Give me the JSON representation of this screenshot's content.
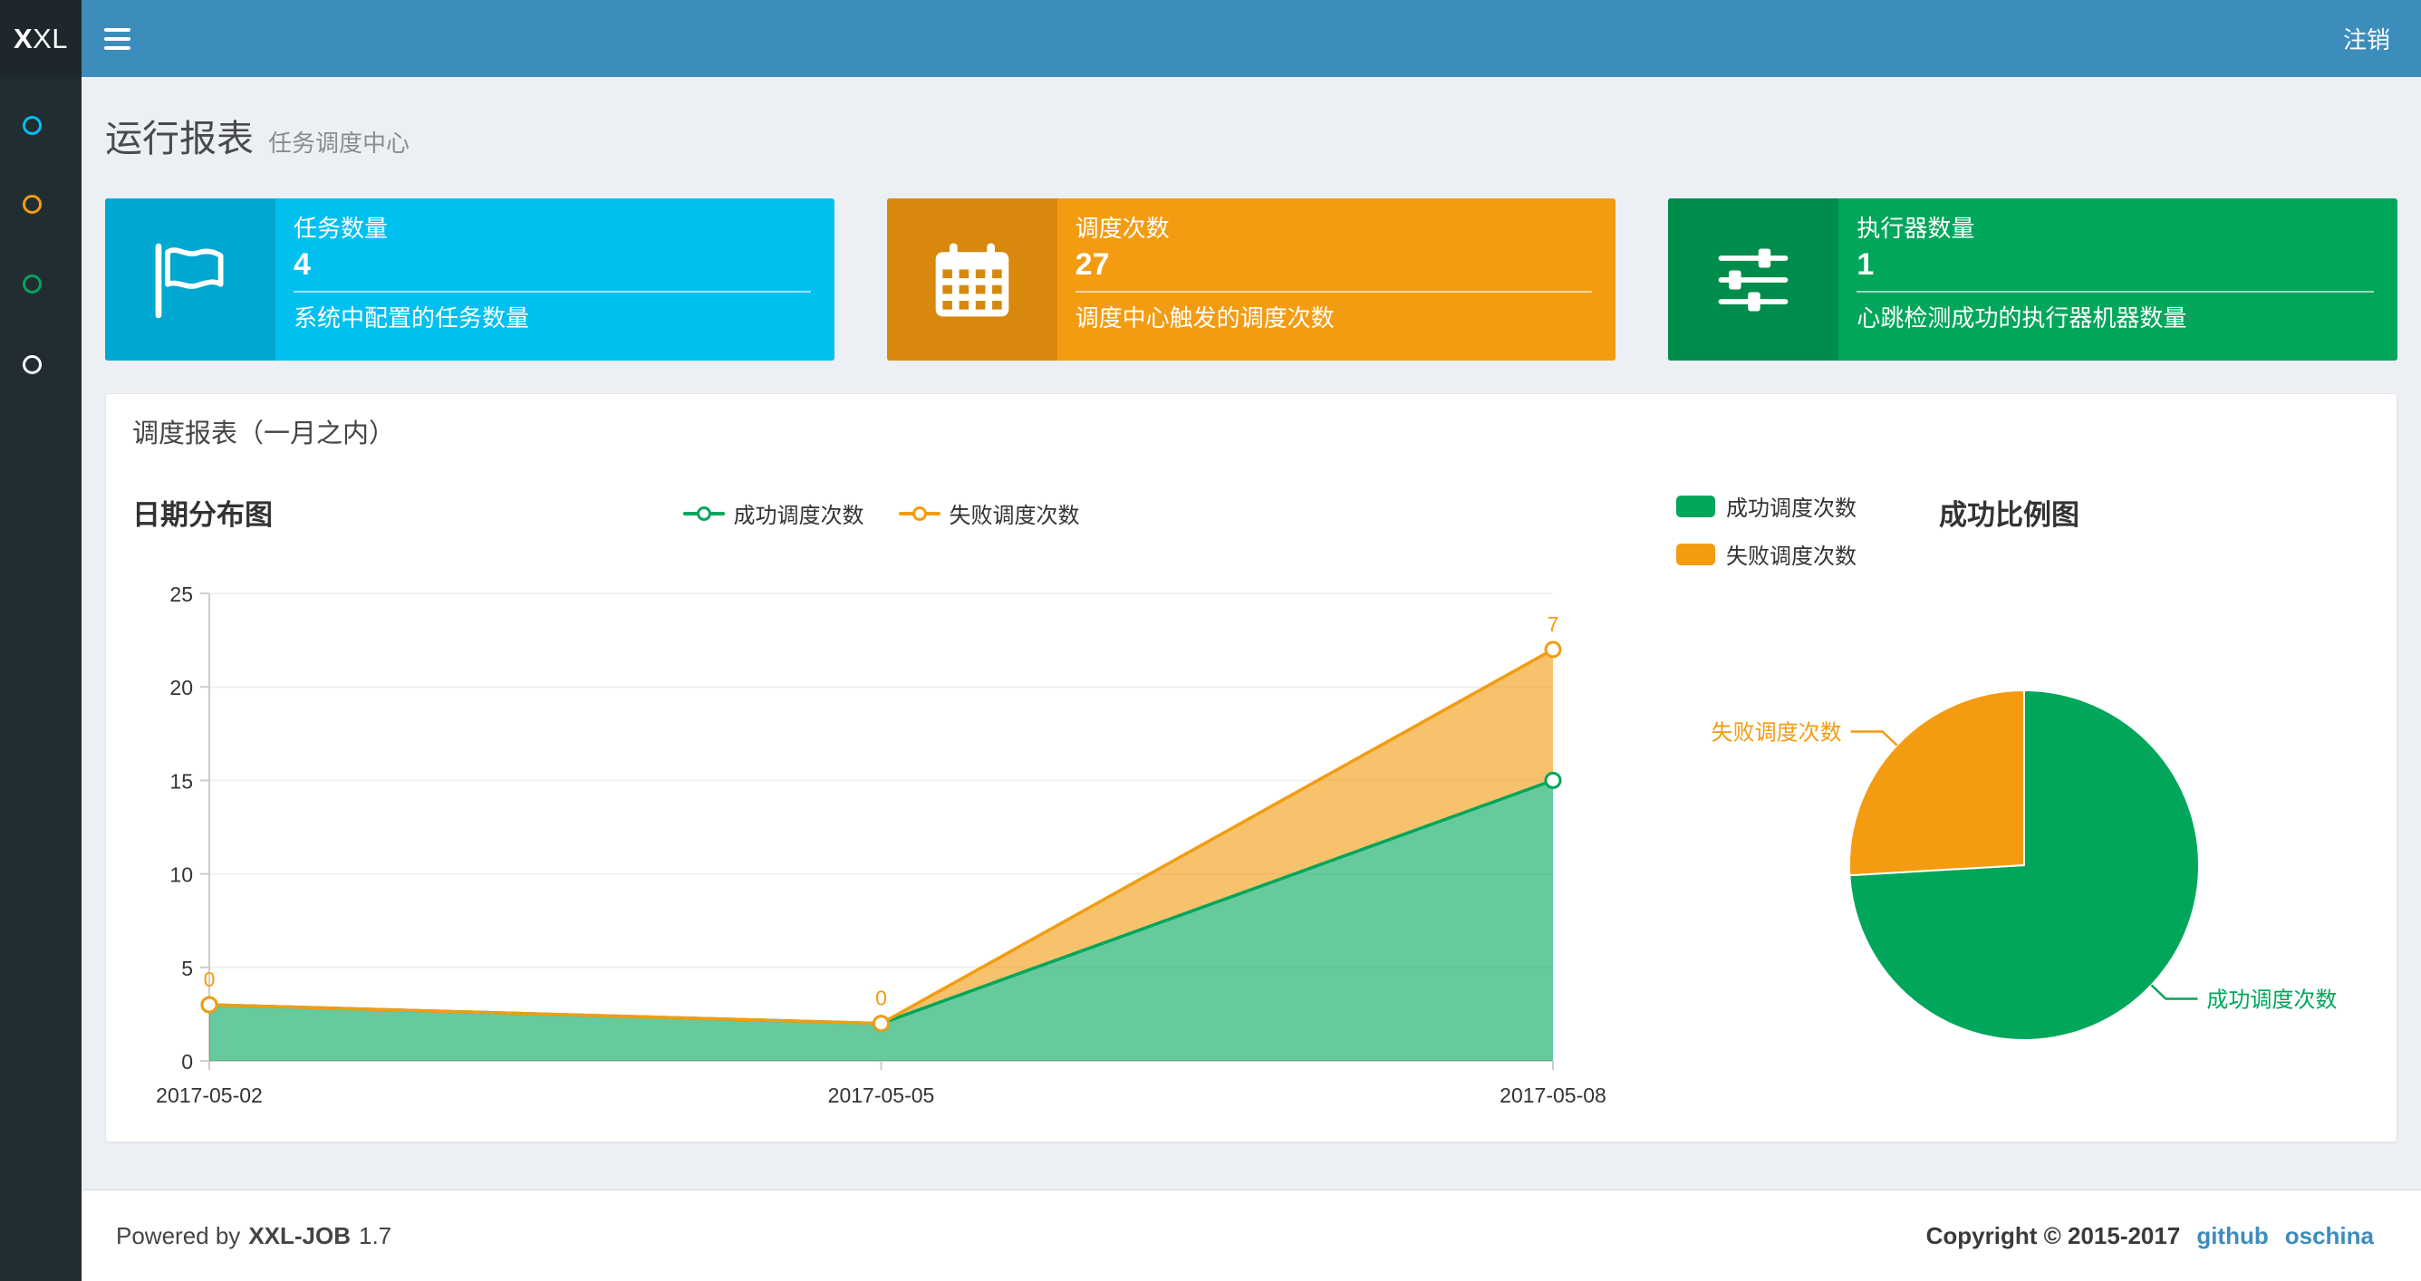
{
  "navbar": {
    "logo_bold": "X",
    "logo_rest": "XL",
    "logout_label": "注销"
  },
  "sidebar": {
    "items": [
      {
        "name": "dashboard",
        "color": "#00c0ef"
      },
      {
        "name": "job-manage",
        "color": "#f39c12"
      },
      {
        "name": "job-log",
        "color": "#00a65a"
      },
      {
        "name": "executor-manage",
        "color": "#ffffff"
      }
    ]
  },
  "page_header": {
    "title": "运行报表",
    "subtitle": "任务调度中心"
  },
  "info_boxes": [
    {
      "title": "任务数量",
      "value": "4",
      "desc": "系统中配置的任务数量",
      "bg": "#00c0ef",
      "icon_bg": "#00a7d0",
      "icon": "flag-icon"
    },
    {
      "title": "调度次数",
      "value": "27",
      "desc": "调度中心触发的调度次数",
      "bg": "#f39c12",
      "icon_bg": "#d8880c",
      "icon": "calendar-icon"
    },
    {
      "title": "执行器数量",
      "value": "1",
      "desc": "心跳检测成功的执行器机器数量",
      "bg": "#00a65a",
      "icon_bg": "#008d4c",
      "icon": "sliders-icon"
    }
  ],
  "panel": {
    "title": "调度报表（一月之内）"
  },
  "chart_data": [
    {
      "type": "area",
      "title": "日期分布图",
      "x": [
        "2017-05-02",
        "2017-05-05",
        "2017-05-08"
      ],
      "stacked": true,
      "series": [
        {
          "name": "成功调度次数",
          "color": "#00a65a",
          "values": [
            3,
            2,
            15
          ]
        },
        {
          "name": "失败调度次数",
          "color": "#f39c12",
          "values": [
            0,
            0,
            7
          ],
          "show_point_labels": true,
          "point_labels": [
            "0",
            "0",
            "7"
          ]
        }
      ],
      "ylim": [
        0,
        25
      ],
      "yticks": [
        0,
        5,
        10,
        15,
        20,
        25
      ],
      "legend_position": "top-center",
      "grid": true
    },
    {
      "type": "pie",
      "title": "成功比例图",
      "slices": [
        {
          "label": "成功调度次数",
          "value": 20,
          "color": "#00a65a"
        },
        {
          "label": "失败调度次数",
          "value": 7,
          "color": "#f39c12"
        }
      ],
      "legend_position": "top-left",
      "label_lines": true
    }
  ],
  "footer": {
    "powered_prefix": "Powered by",
    "product": "XXL-JOB",
    "version": "1.7",
    "copyright": "Copyright © 2015-2017",
    "links": [
      {
        "label": "github"
      },
      {
        "label": "oschina"
      }
    ]
  }
}
